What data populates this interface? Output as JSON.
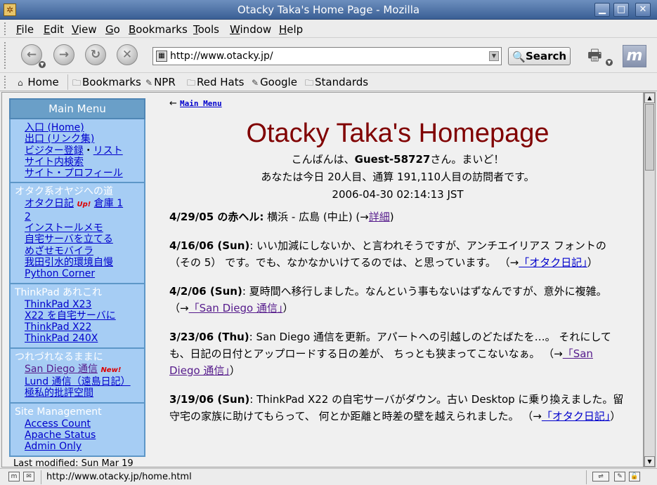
{
  "window": {
    "title": "Otacky Taka's Home Page - Mozilla",
    "app_icon": "mozilla-icon",
    "controls": [
      "minimize-icon",
      "maximize-icon",
      "close-icon"
    ]
  },
  "menubar": {
    "items": [
      {
        "label": "File",
        "key": "F",
        "rest": "ile"
      },
      {
        "label": "Edit",
        "key": "E",
        "rest": "dit"
      },
      {
        "label": "View",
        "key": "V",
        "rest": "iew"
      },
      {
        "label": "Go",
        "key": "G",
        "rest": "o"
      },
      {
        "label": "Bookmarks",
        "key": "B",
        "rest": "ookmarks"
      },
      {
        "label": "Tools",
        "key": "T",
        "rest": "ools"
      },
      {
        "label": "Window",
        "key": "W",
        "rest": "indow"
      },
      {
        "label": "Help",
        "key": "H",
        "rest": "elp"
      }
    ]
  },
  "navbar": {
    "back_icon": "back-arrow-icon",
    "forward_icon": "forward-arrow-icon",
    "reload_icon": "reload-icon",
    "stop_icon": "stop-icon",
    "url": "http://www.otacky.jp/",
    "search_label": "Search",
    "print_icon": "printer-icon",
    "throbber_icon": "mozilla-m-icon"
  },
  "personal_toolbar": {
    "items": [
      {
        "label": "Home",
        "icon": "home-icon"
      },
      {
        "label": "Bookmarks",
        "icon": "folder-icon"
      },
      {
        "label": "NPR",
        "icon": "bookmark-icon"
      },
      {
        "label": "Red Hats",
        "icon": "folder-icon"
      },
      {
        "label": "Google",
        "icon": "bookmark-icon"
      },
      {
        "label": "Standards",
        "icon": "folder-icon"
      }
    ]
  },
  "sidebar": {
    "title": "Main Menu",
    "sections": [
      {
        "heading": "",
        "links": [
          "入口 (Home)",
          "出口 (リンク集)",
          "ビジター登録",
          "リスト",
          "サイト内検索",
          "サイト・プロフィール"
        ]
      },
      {
        "heading": "オタク系オヤジへの道",
        "links": [
          "オタク日記",
          "倉庫 1",
          "2",
          "インストールメモ",
          "自宅サーバを立てる",
          "めざせモバイラ",
          "我田引水的環境自慢",
          "Python Corner"
        ],
        "badge": "Up!"
      },
      {
        "heading": "ThinkPad あれこれ",
        "links": [
          "ThinkPad X23",
          "X22 を自宅サーバに",
          "ThinkPad X22",
          "ThinkPad 240X"
        ]
      },
      {
        "heading": "つれづれなるままに",
        "links": [
          "San Diego 通信",
          "Lund 通信（遠島日記）",
          "極私的批評空間"
        ],
        "badge": "New!"
      },
      {
        "heading": "Site Management",
        "links": [
          "Access Count",
          "Apache Status",
          "Admin Only"
        ]
      }
    ],
    "footer": "Last modified: Sun Mar 19"
  },
  "main": {
    "back_arrow": "←",
    "back_link": "Main Menu",
    "title": "Otacky Taka's Homepage",
    "greeting": {
      "line1_prefix": "こんばんは、",
      "guest": "Guest-58727",
      "line1_suffix": "さん。まいど！",
      "line2": "あなたは今日 20人目、通算 191,110人目の訪問者です。",
      "line3": "2006-04-30 02:14:13 JST"
    },
    "news": [
      {
        "date": "4/29/05 の赤ヘル:",
        "text": " 横浜 - 広島 (中止) (→",
        "link": "詳細",
        "tail": ")"
      },
      {
        "date": "4/16/06 (Sun)",
        "text": ": いい加減にしないか、と言われそうですが、アンチエイリアス フォントの（その 5） です。でも、なかなかいけてるのでは、と思っています。 （→",
        "link": "「オタク日記」",
        "tail": "）"
      },
      {
        "date": "4/2/06 (Sun)",
        "text": ": 夏時間へ移行しました。なんという事もないはずなんですが、意外に複雑。 （→",
        "link": "「San Diego 通信」",
        "tail": "）"
      },
      {
        "date": "3/23/06 (Thu)",
        "text": ": San Diego 通信を更新。アパートへの引越しのどたばたを…。 それにしても、日記の日付とアップロードする日の差が、 ちっとも狭まってこないなぁ。 （→",
        "link": "「San Diego 通信」",
        "tail": "）"
      },
      {
        "date": "3/19/06 (Sun)",
        "text": ": ThinkPad X22 の自宅サーバがダウン。古い Desktop に乗り換えました。留守宅の家族に助けてもらって、 何とか距離と時差の壁を越えられました。 （→",
        "link": "「オタク日記」",
        "tail": "）"
      }
    ]
  },
  "statusbar": {
    "text": "http://www.otacky.jp/home.html"
  }
}
